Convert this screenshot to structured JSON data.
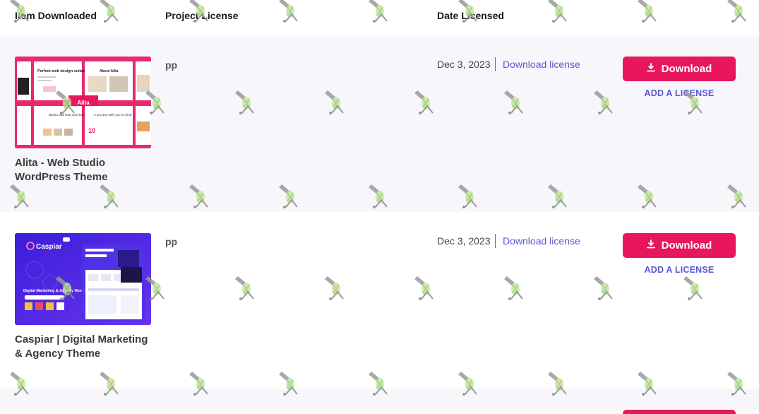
{
  "columns": {
    "item": "Item Downloaded",
    "license": "Project License",
    "date": "Date Licensed"
  },
  "rows": [
    {
      "title": "Alita - Web Studio WordPress Theme",
      "license": "pp",
      "date": "Dec 3, 2023",
      "download_license_label": "Download license",
      "download_label": "Download",
      "add_license_label": "ADD A LICENSE",
      "thumb": {
        "headline": "Perfect web design suitable for your business.",
        "badge": "Alita",
        "panel_about": "About Alita",
        "panel_bottom_left": "Basics that lead and inspire real results",
        "panel_bottom_mid": "A process with you in mind",
        "number": "10"
      }
    },
    {
      "title": "Caspiar | Digital Marketing & Agency Theme",
      "license": "pp",
      "date": "Dec 3, 2023",
      "download_license_label": "Download license",
      "download_label": "Download",
      "add_license_label": "ADD A LICENSE",
      "thumb": {
        "brand": "Caspiar",
        "tagline": "Digital Marketing & Agency WordPress Theme"
      }
    }
  ],
  "colors": {
    "primary_button": "#e8175d",
    "link": "#5856d6",
    "row_alt_bg": "#f7f7fb"
  },
  "icons": {
    "download": "download-icon"
  }
}
